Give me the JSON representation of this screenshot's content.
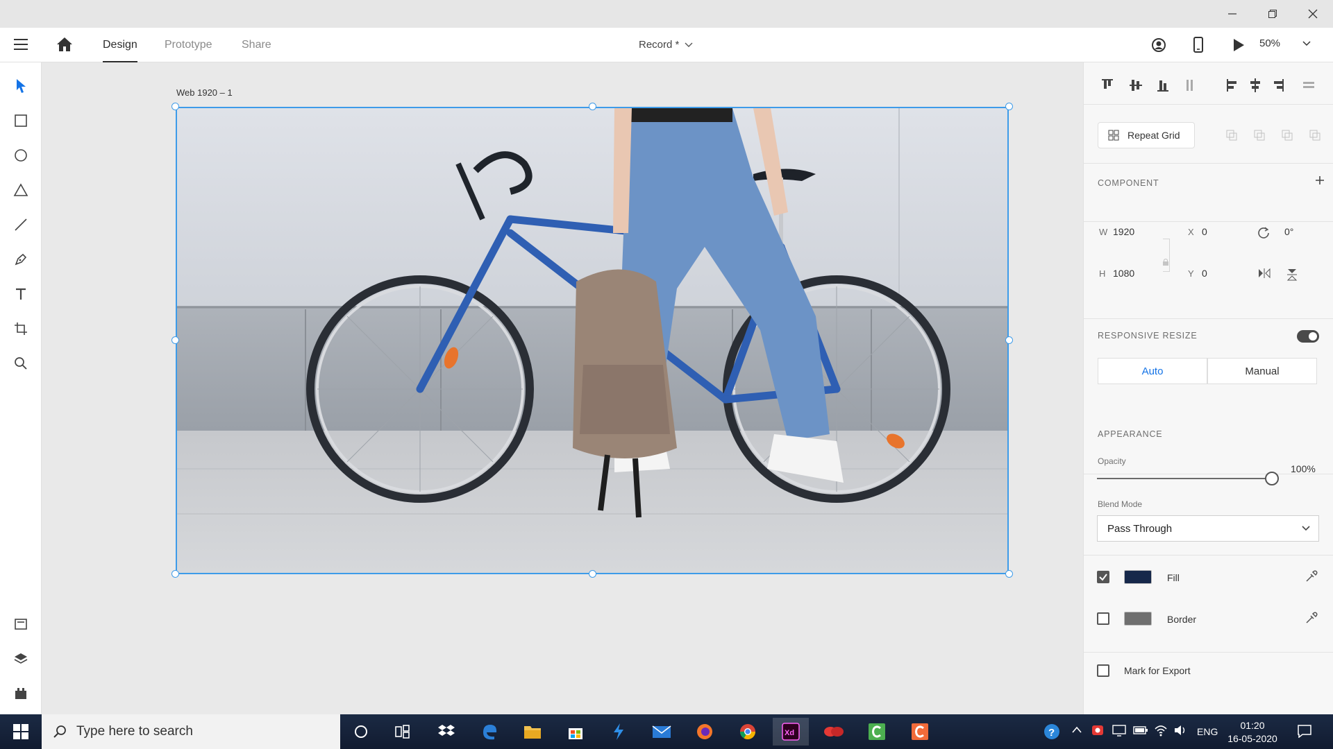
{
  "header": {
    "tabs": [
      "Design",
      "Prototype",
      "Share"
    ],
    "document_title": "Record *",
    "zoom": "50%"
  },
  "canvas": {
    "artboard_label": "Web 1920 – 1"
  },
  "panel": {
    "repeat_grid_label": "Repeat Grid",
    "component_title": "COMPONENT",
    "w_label": "W",
    "w_value": "1920",
    "h_label": "H",
    "h_value": "1080",
    "x_label": "X",
    "x_value": "0",
    "y_label": "Y",
    "y_value": "0",
    "rotation_value": "0°",
    "responsive_title": "RESPONSIVE RESIZE",
    "responsive_enabled": true,
    "resize_auto": "Auto",
    "resize_manual": "Manual",
    "appearance_title": "APPEARANCE",
    "opacity_label": "Opacity",
    "opacity_value": "100%",
    "opacity_fraction": 1.0,
    "blend_label": "Blend Mode",
    "blend_value": "Pass Through",
    "fill_label": "Fill",
    "fill_checked": true,
    "fill_color": "#16284a",
    "border_label": "Border",
    "border_checked": false,
    "border_color": "#6f6f6f",
    "export_label": "Mark for Export",
    "export_checked": false
  },
  "taskbar": {
    "search_placeholder": "Type here to search",
    "language": "ENG",
    "time": "01:20",
    "date": "16-05-2020"
  },
  "colors": {
    "accent": "#3d9be9",
    "selection_tool": "#1473e6"
  }
}
